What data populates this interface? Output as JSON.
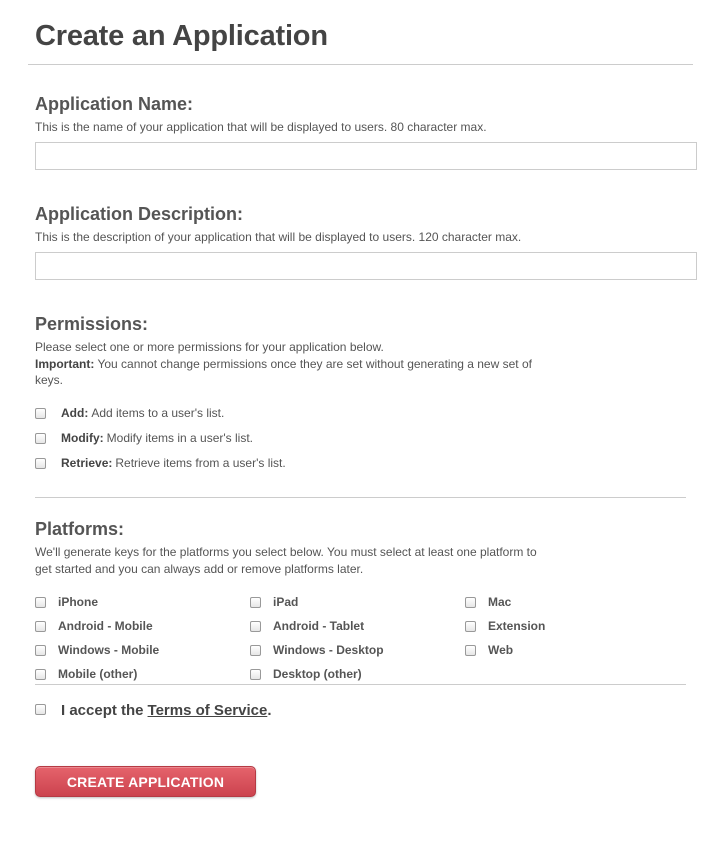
{
  "page": {
    "title": "Create an Application"
  },
  "app_name": {
    "label": "Application Name:",
    "help": "This is the name of your application that will be displayed to users. 80 character max.",
    "value": "",
    "placeholder": ""
  },
  "app_description": {
    "label": "Application Description:",
    "help": "This is the description of your application that will be displayed to users. 120 character max.",
    "value": "",
    "placeholder": ""
  },
  "permissions": {
    "label": "Permissions:",
    "help_line1": "Please select one or more permissions for your application below.",
    "important_label": "Important:",
    "important_text": "You cannot change permissions once they are set without generating a new set of",
    "important_text_line2": "keys.",
    "items": [
      {
        "name": "Add:",
        "description": "Add items to a user's list.",
        "checked": false
      },
      {
        "name": "Modify:",
        "description": "Modify items in a user's list.",
        "checked": false
      },
      {
        "name": "Retrieve:",
        "description": "Retrieve items from a user's list.",
        "checked": false
      }
    ]
  },
  "platforms": {
    "label": "Platforms:",
    "help_line1": "We'll generate keys for the platforms you select below. You must select at least one platform to",
    "help_line2": "get started and you can always add or remove platforms later.",
    "items": [
      {
        "label": "iPhone",
        "checked": false
      },
      {
        "label": "iPad",
        "checked": false
      },
      {
        "label": "Mac",
        "checked": false
      },
      {
        "label": "Android - Mobile",
        "checked": false
      },
      {
        "label": "Android - Tablet",
        "checked": false
      },
      {
        "label": "Extension",
        "checked": false
      },
      {
        "label": "Windows - Mobile",
        "checked": false
      },
      {
        "label": "Windows - Desktop",
        "checked": false
      },
      {
        "label": "Web",
        "checked": false
      },
      {
        "label": "Mobile (other)",
        "checked": false
      },
      {
        "label": "Desktop (other)",
        "checked": false
      }
    ]
  },
  "terms": {
    "prefix": "I accept the",
    "link_text": "Terms of Service",
    "suffix": ".",
    "checked": false
  },
  "submit": {
    "label": "CREATE APPLICATION"
  },
  "colors": {
    "button_top": "#e5636c",
    "button_bottom": "#cc434e",
    "text": "#444444",
    "border": "#cccccc"
  }
}
